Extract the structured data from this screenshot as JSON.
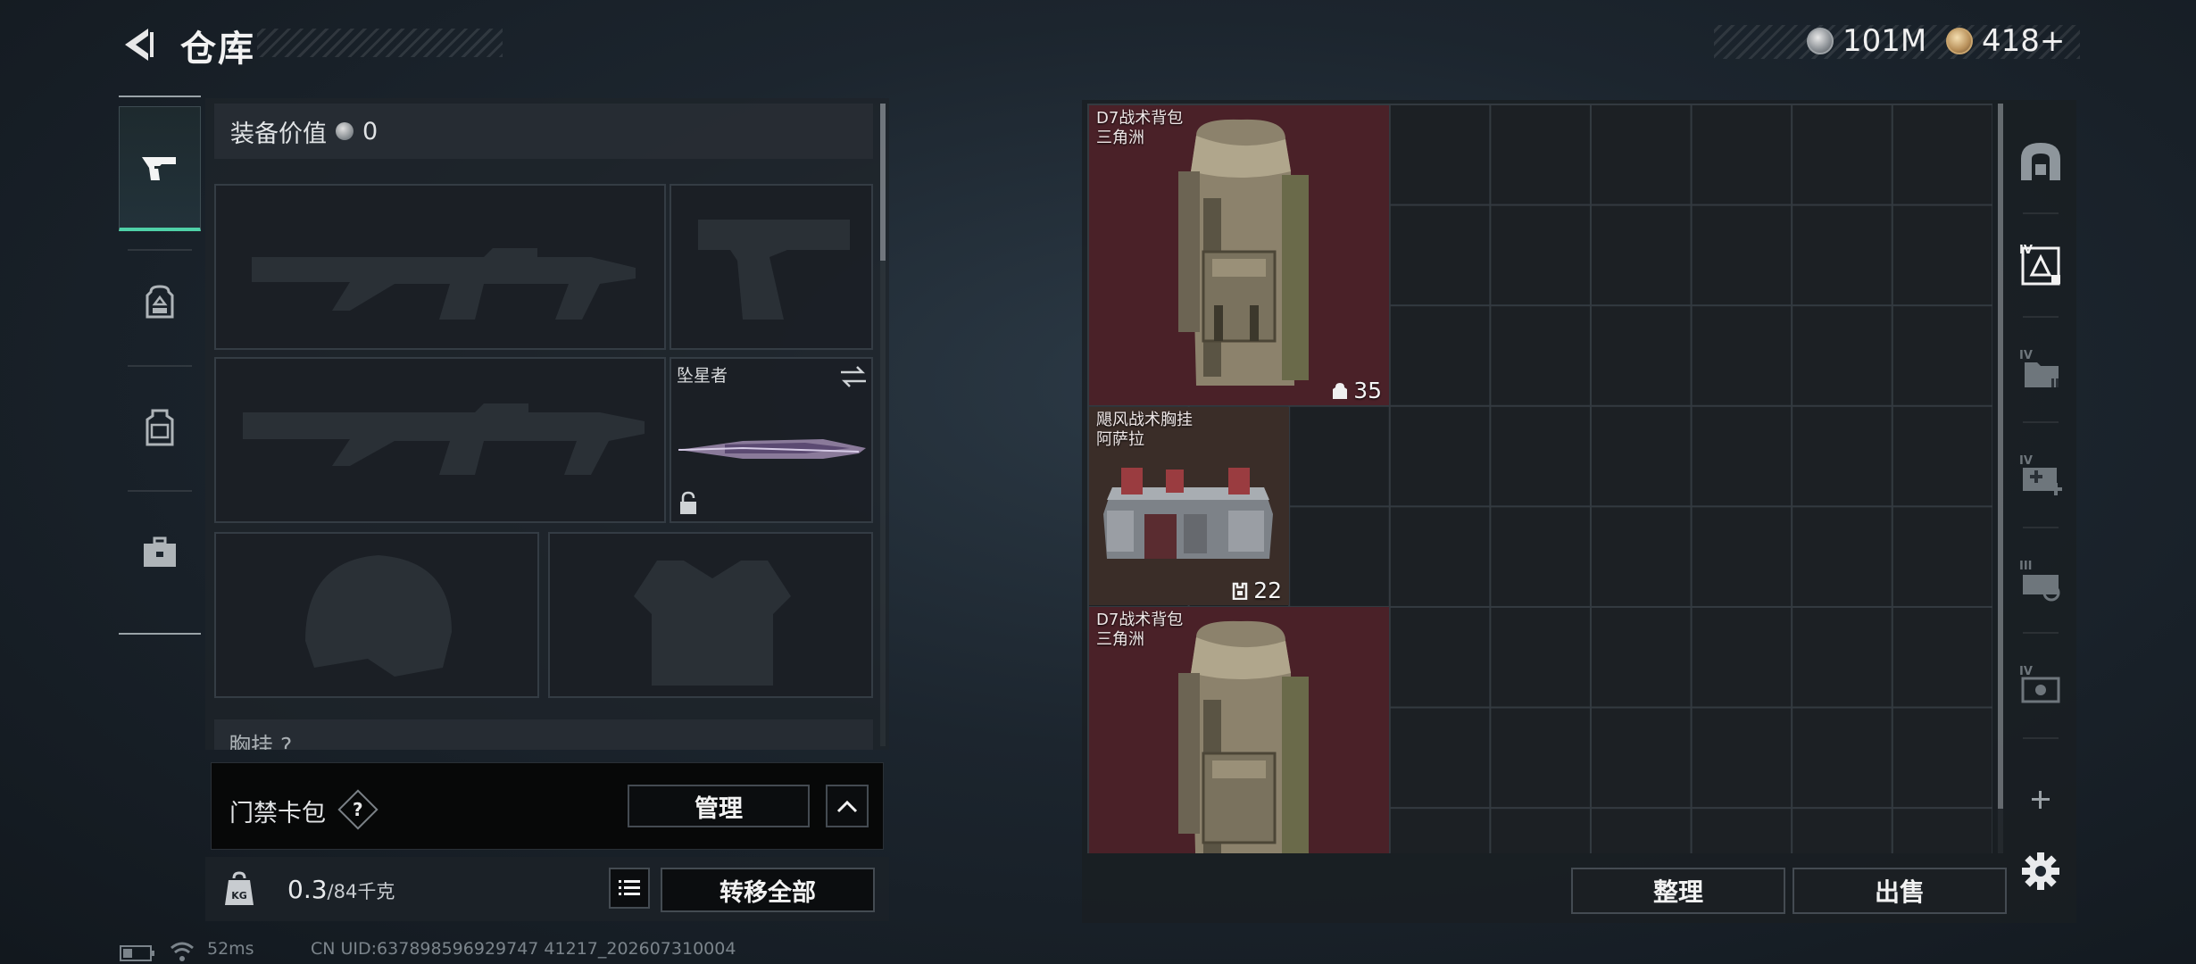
{
  "header": {
    "title": "仓库",
    "currency_silver": "101M",
    "currency_gold": "418+"
  },
  "left_rail": {
    "items": [
      {
        "icon": "pistol-icon",
        "active": true
      },
      {
        "icon": "backpack-icon",
        "active": false
      },
      {
        "icon": "vest-icon",
        "active": false
      },
      {
        "icon": "toolbox-icon",
        "active": false
      }
    ]
  },
  "loadout": {
    "equip_value_label": "装备价值",
    "equip_value": "0",
    "melee_name": "坠星者",
    "chest_rig_label": "胸挂 ?"
  },
  "keycard": {
    "label": "门禁卡包",
    "help": "?",
    "manage_label": "管理"
  },
  "weight": {
    "current": "0.3",
    "max": "/84千克",
    "transfer_all_label": "转移全部"
  },
  "status_bar": {
    "ping": "52ms",
    "uid": "CN UID:637898596929747 41217_202607310004"
  },
  "storage": {
    "items": [
      {
        "line1": "D7战术背包",
        "line2": "三角洲",
        "count": "35",
        "count_icon": "backpack-capacity-icon"
      },
      {
        "line1": "飓风战术胸挂",
        "line2": "阿萨拉",
        "count": "22",
        "count_icon": "rig-capacity-icon"
      },
      {
        "line1": "D7战术背包",
        "line2": "三角洲"
      }
    ],
    "sort_label": "整理",
    "sell_label": "出售"
  },
  "right_rail": {
    "icons": [
      "safe-box-icon",
      "tier-iv-storage-icon",
      "tier-iv-folder-icon",
      "tier-iv-medkit-icon",
      "tier-iii-ammo-icon",
      "tier-iv-armor-icon",
      "add-icon",
      "settings-icon"
    ]
  },
  "colors": {
    "accent_green": "#4fd1a8",
    "item_red": "#4a2128",
    "item_brown": "#3a2d28"
  }
}
